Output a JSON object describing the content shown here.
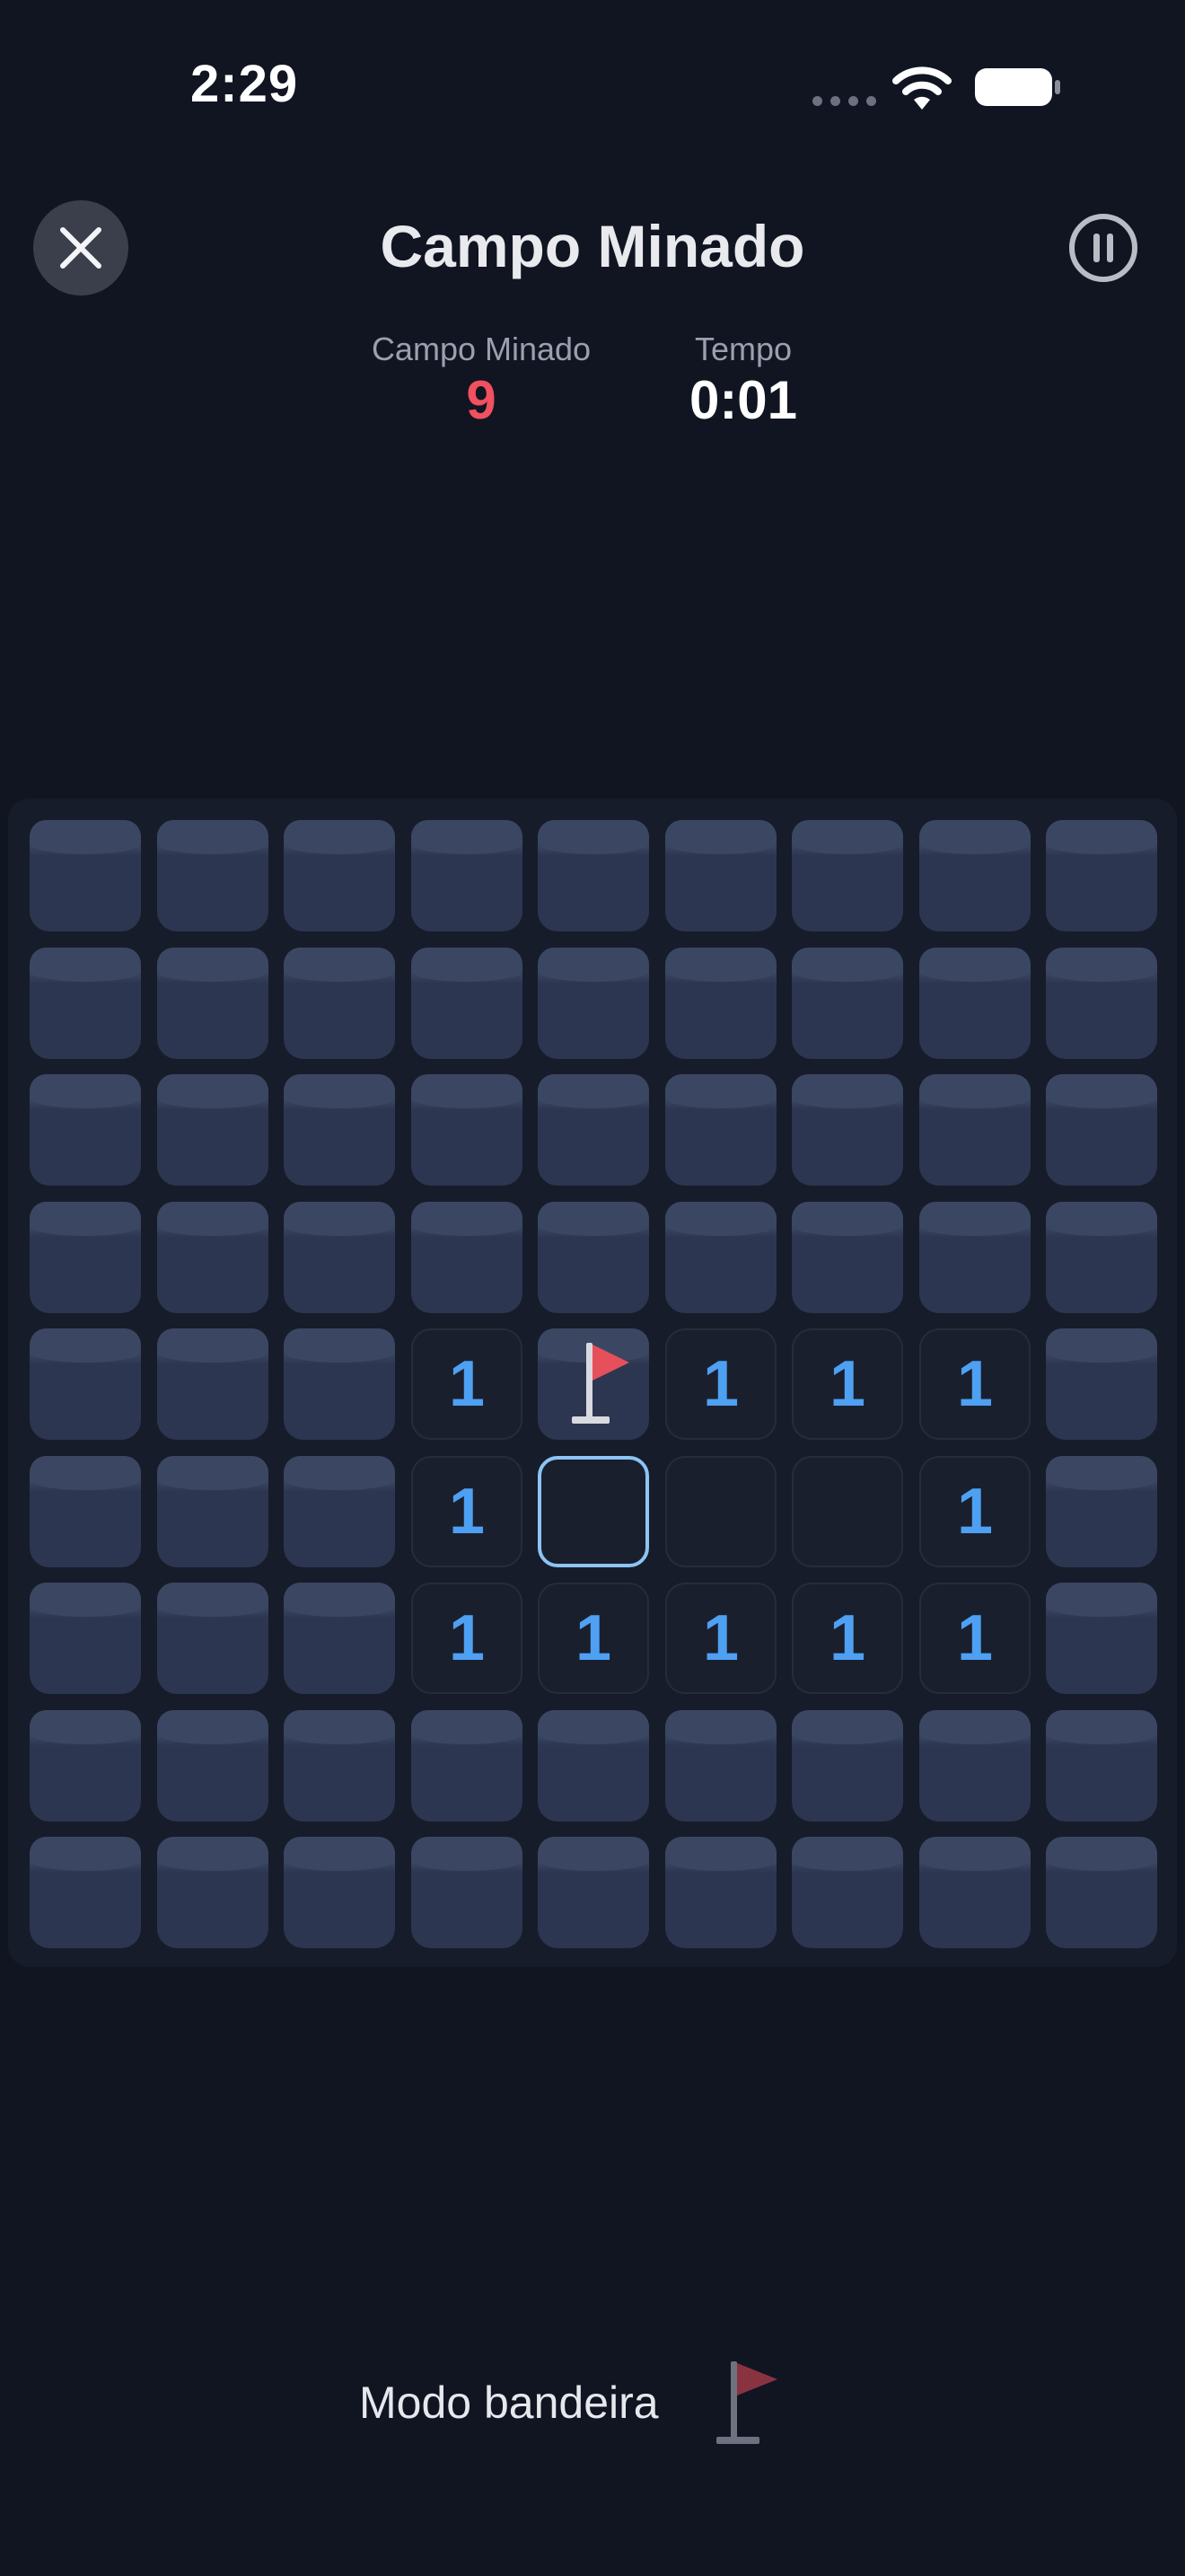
{
  "status_bar": {
    "time": "2:29"
  },
  "header": {
    "title": "Campo Minado",
    "close_icon": "close-icon",
    "pause_icon": "pause-icon"
  },
  "stats": {
    "mines_label": "Campo Minado",
    "mines_value": "9",
    "time_label": "Tempo",
    "time_value": "0:01"
  },
  "board": {
    "columns": 9,
    "rows": 9,
    "legend": {
      "C": "covered",
      "E": "revealed-empty",
      "F": "flagged",
      "S": "selected",
      "1": "number 1"
    },
    "grid": [
      "CCCCCCCCC",
      "CCCCCCCCC",
      "CCCCCCCCC",
      "CCCCCCCCC",
      "CCC1F111C",
      "CCC1SEE1C",
      "CCC11111C",
      "CCCCCCCCC",
      "CCCCCCCCC"
    ]
  },
  "footer": {
    "flag_mode_label": "Modo bandeira",
    "flag_icon": "flag-icon"
  },
  "colors": {
    "background": "#111522",
    "board": "#171c2a",
    "number": "#4ea0f2",
    "mines_counter": "#f0505f",
    "selected_outline": "#8cc4f4",
    "flag": "#e5505b"
  }
}
